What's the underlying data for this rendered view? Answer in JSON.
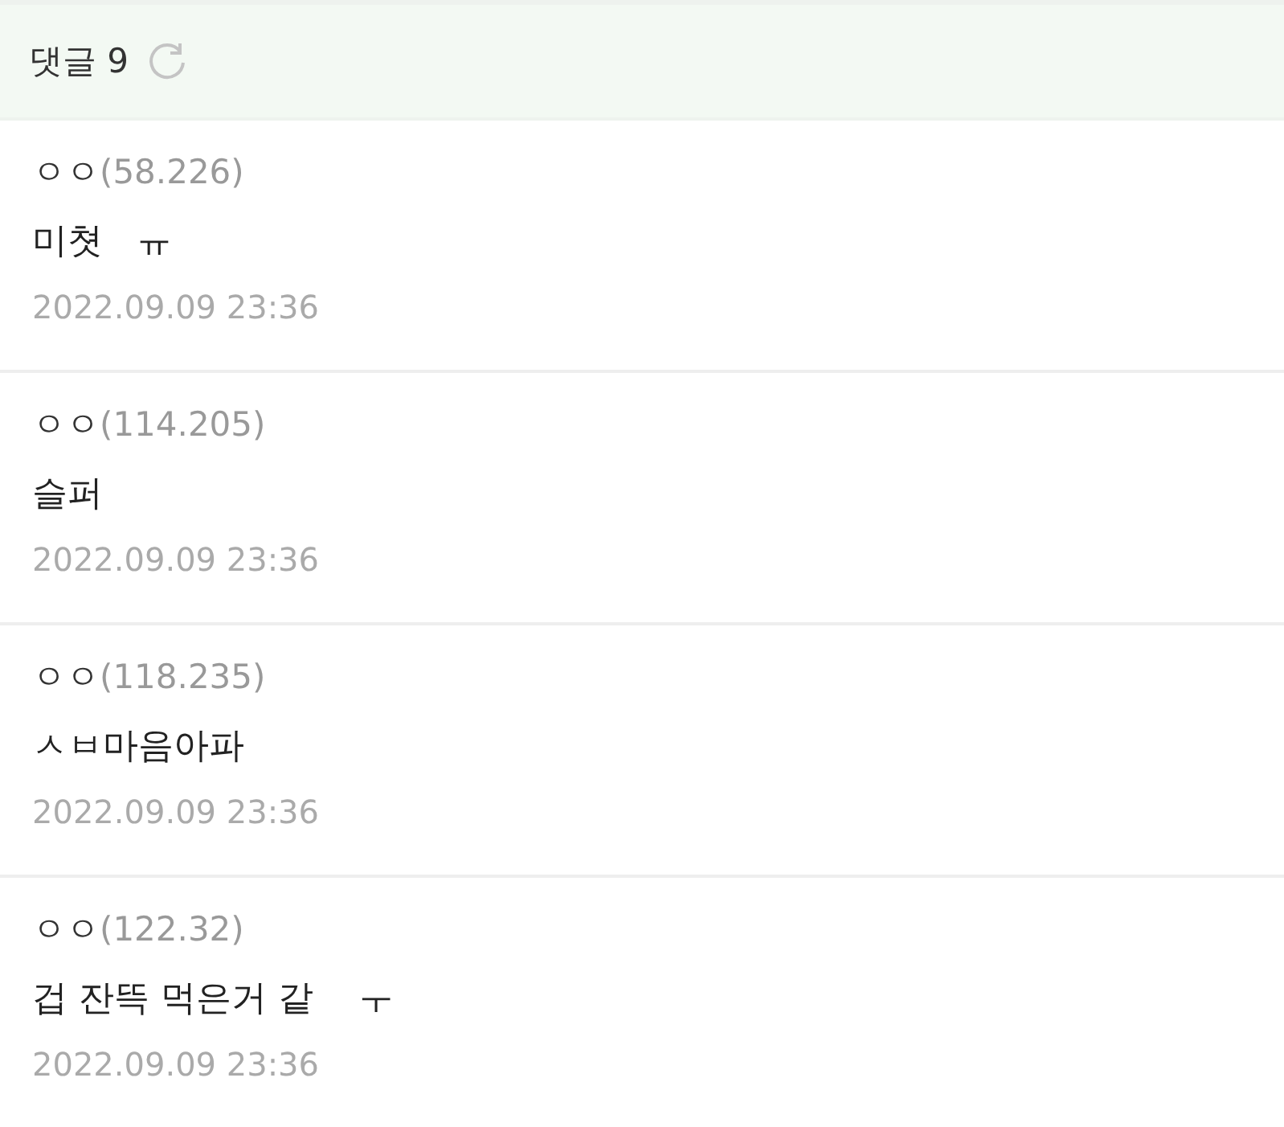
{
  "header": {
    "title": "댓글",
    "count": "9"
  },
  "comments": [
    {
      "nickname": "ㅇㅇ",
      "ip": "(58.226)",
      "text": "미쳣   ㅠ",
      "date": "2022.09.09 23:36"
    },
    {
      "nickname": "ㅇㅇ",
      "ip": "(114.205)",
      "text": "슬퍼",
      "date": "2022.09.09 23:36"
    },
    {
      "nickname": "ㅇㅇ",
      "ip": "(118.235)",
      "text": "ㅅㅂ마음아파",
      "date": "2022.09.09 23:36"
    },
    {
      "nickname": "ㅇㅇ",
      "ip": "(122.32)",
      "text": "겁 잔뜩 먹은거 같    ㅜ",
      "date": "2022.09.09 23:36"
    }
  ]
}
